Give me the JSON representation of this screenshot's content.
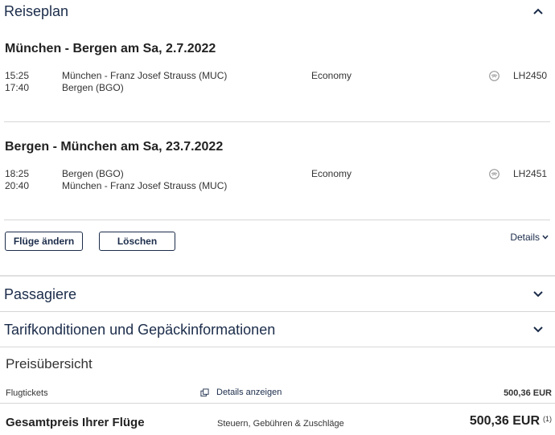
{
  "itinerary": {
    "title": "Reiseplan",
    "legs": [
      {
        "heading": "München - Bergen am Sa, 2.7.2022",
        "departure_time": "15:25",
        "departure_airport": "München - Franz Josef Strauss (MUC)",
        "arrival_time": "17:40",
        "arrival_airport": "Bergen (BGO)",
        "cabin": "Economy",
        "flight": "LH2450"
      },
      {
        "heading": "Bergen - München am Sa, 23.7.2022",
        "departure_time": "18:25",
        "departure_airport": "Bergen (BGO)",
        "arrival_time": "20:40",
        "arrival_airport": "München - Franz Josef Strauss (MUC)",
        "cabin": "Economy",
        "flight": "LH2451"
      }
    ],
    "change_button": "Flüge ändern",
    "delete_button": "Löschen",
    "details_link": "Details"
  },
  "passengers": {
    "title": "Passagiere"
  },
  "tariff": {
    "title": "Tarifkonditionen und Gepäckinformationen"
  },
  "price": {
    "title": "Preisübersicht",
    "tickets_label": "Flugtickets",
    "show_details": "Details anzeigen",
    "tickets_amount": "500,36 EUR",
    "total_label": "Gesamtpreis Ihrer Flüge",
    "taxes_label": "Steuern, Gebühren & Zuschläge",
    "total_amount": "500,36 EUR",
    "footnote": "(1)"
  },
  "icons": {
    "collapse": "chevron-up-icon",
    "expand": "chevron-down-icon",
    "airline_logo": "lufthansa-crane-icon",
    "external": "popup-window-icon"
  },
  "colors": {
    "accent": "#1b2c4a",
    "divider": "#d6d6d6"
  }
}
